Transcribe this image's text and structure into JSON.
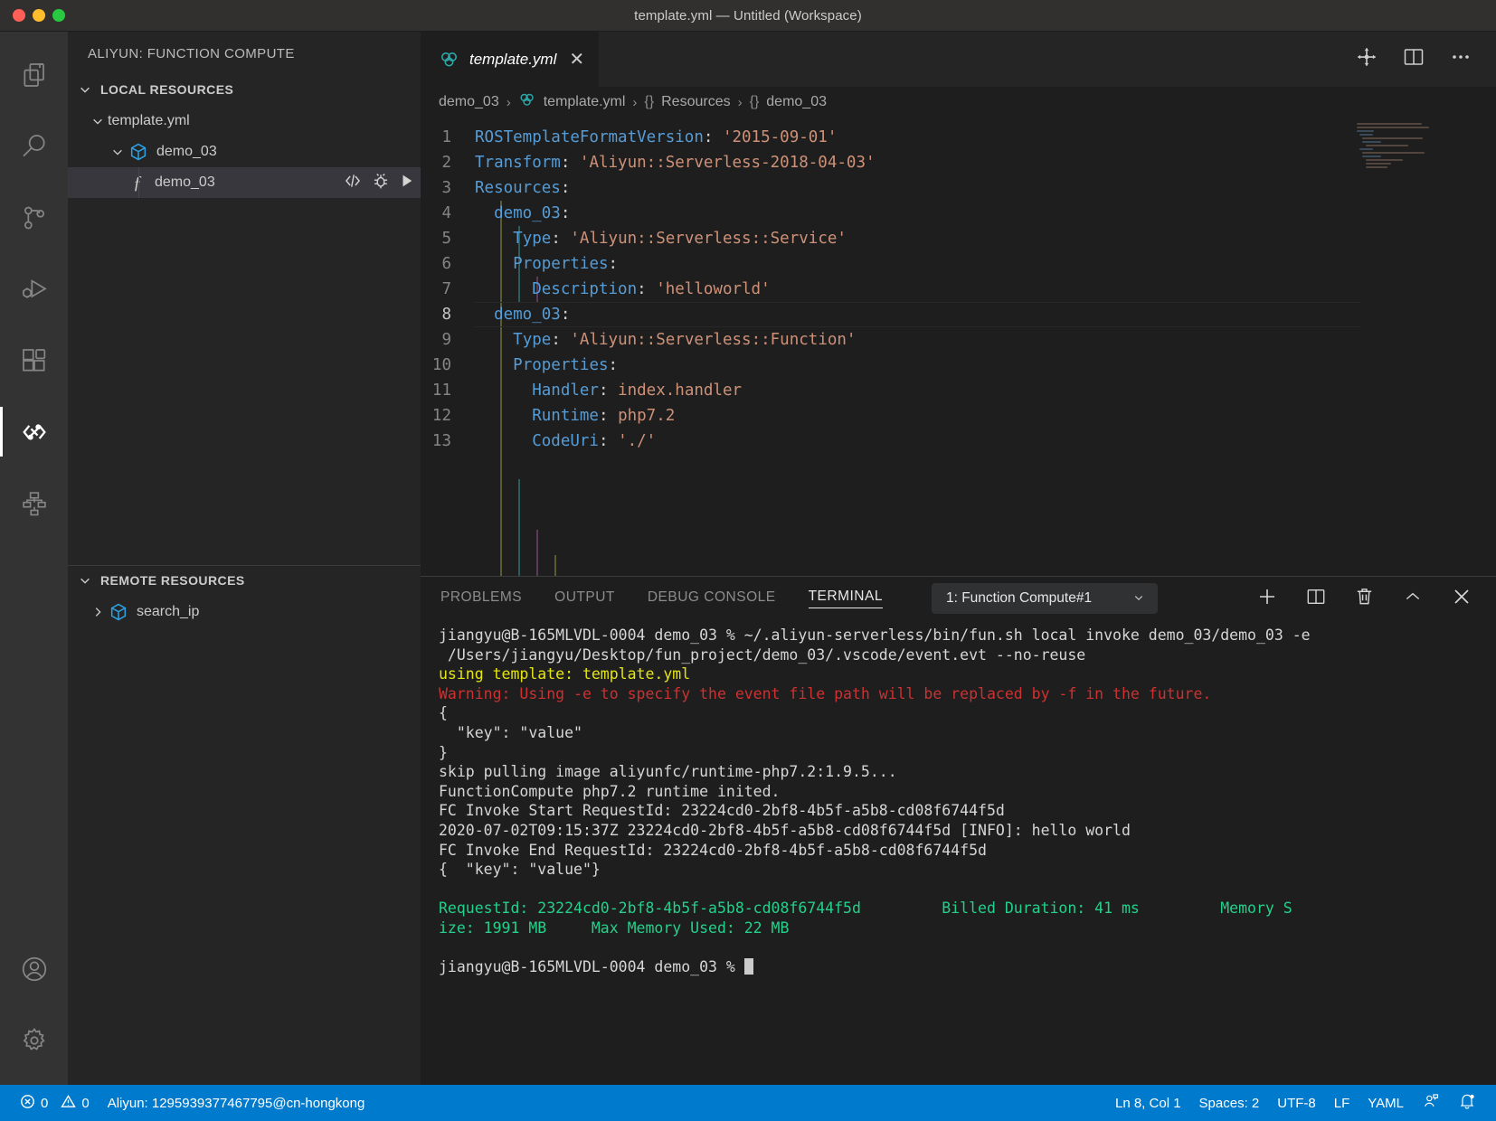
{
  "window": {
    "title": "template.yml — Untitled (Workspace)"
  },
  "activitybar": {
    "items": [
      {
        "name": "explorer",
        "icon": "files-icon",
        "active": false
      },
      {
        "name": "search",
        "icon": "search-icon",
        "active": false
      },
      {
        "name": "source-control",
        "icon": "source-control-icon",
        "active": false
      },
      {
        "name": "run-and-debug",
        "icon": "debug-icon",
        "active": false
      },
      {
        "name": "extensions",
        "icon": "extensions-icon",
        "active": false
      },
      {
        "name": "function-compute",
        "icon": "serverless-icon",
        "active": true
      },
      {
        "name": "remote-explorer",
        "icon": "sitemap-icon",
        "active": false
      }
    ],
    "bottom": [
      {
        "name": "accounts",
        "icon": "account-icon"
      },
      {
        "name": "manage",
        "icon": "gear-icon"
      }
    ]
  },
  "sidebar": {
    "title": "ALIYUN: FUNCTION COMPUTE",
    "local": {
      "header": "LOCAL RESOURCES",
      "items": [
        {
          "label": "template.yml",
          "level": 1,
          "twisty": "expanded",
          "icon": "none",
          "selected": false
        },
        {
          "label": "demo_03",
          "level": 2,
          "twisty": "expanded",
          "icon": "cube-icon",
          "selected": false
        },
        {
          "label": "demo_03",
          "level": 3,
          "twisty": "none",
          "icon": "function-icon",
          "selected": true,
          "actions": [
            "code-icon",
            "bug-icon",
            "play-icon"
          ]
        }
      ]
    },
    "remote": {
      "header": "REMOTE RESOURCES",
      "items": [
        {
          "label": "search_ip",
          "level": 1,
          "twisty": "collapsed",
          "icon": "cube-icon",
          "selected": false
        }
      ]
    }
  },
  "editor": {
    "tab": {
      "label": "template.yml",
      "icon": "yaml-cloud-icon",
      "close": "✕"
    },
    "tab_actions": [
      "split-layout-icon",
      "split-editor-icon",
      "more-actions-icon"
    ],
    "breadcrumbs": [
      {
        "text": "demo_03",
        "icon": "none"
      },
      {
        "text": "template.yml",
        "icon": "yaml-cloud-icon"
      },
      {
        "text": "Resources",
        "icon": "braces"
      },
      {
        "text": "demo_03",
        "icon": "braces"
      }
    ],
    "separator": "❯",
    "current_line": 8,
    "lines": [
      {
        "n": 1,
        "tokens": [
          {
            "t": "ROSTemplateFormatVersion",
            "c": "k"
          },
          {
            "t": ": ",
            "c": "p"
          },
          {
            "t": "'2015-09-01'",
            "c": "s"
          }
        ]
      },
      {
        "n": 2,
        "tokens": [
          {
            "t": "Transform",
            "c": "k"
          },
          {
            "t": ": ",
            "c": "p"
          },
          {
            "t": "'Aliyun::Serverless-2018-04-03'",
            "c": "s"
          }
        ]
      },
      {
        "n": 3,
        "tokens": [
          {
            "t": "Resources",
            "c": "k"
          },
          {
            "t": ":",
            "c": "p"
          }
        ]
      },
      {
        "n": 4,
        "tokens": [
          {
            "t": "  ",
            "c": "p"
          },
          {
            "t": "demo_03",
            "c": "k"
          },
          {
            "t": ":",
            "c": "p"
          }
        ]
      },
      {
        "n": 5,
        "tokens": [
          {
            "t": "    ",
            "c": "p"
          },
          {
            "t": "Type",
            "c": "k"
          },
          {
            "t": ": ",
            "c": "p"
          },
          {
            "t": "'Aliyun::Serverless::Service'",
            "c": "s"
          }
        ]
      },
      {
        "n": 6,
        "tokens": [
          {
            "t": "    ",
            "c": "p"
          },
          {
            "t": "Properties",
            "c": "k"
          },
          {
            "t": ":",
            "c": "p"
          }
        ]
      },
      {
        "n": 7,
        "tokens": [
          {
            "t": "      ",
            "c": "p"
          },
          {
            "t": "Description",
            "c": "k"
          },
          {
            "t": ": ",
            "c": "p"
          },
          {
            "t": "'helloworld'",
            "c": "s"
          }
        ]
      },
      {
        "n": 8,
        "tokens": [
          {
            "t": "  ",
            "c": "p"
          },
          {
            "t": "demo_03",
            "c": "k"
          },
          {
            "t": ":",
            "c": "p"
          }
        ]
      },
      {
        "n": 9,
        "tokens": [
          {
            "t": "    ",
            "c": "p"
          },
          {
            "t": "Type",
            "c": "k"
          },
          {
            "t": ": ",
            "c": "p"
          },
          {
            "t": "'Aliyun::Serverless::Function'",
            "c": "s"
          }
        ]
      },
      {
        "n": 10,
        "tokens": [
          {
            "t": "    ",
            "c": "p"
          },
          {
            "t": "Properties",
            "c": "k"
          },
          {
            "t": ":",
            "c": "p"
          }
        ]
      },
      {
        "n": 11,
        "tokens": [
          {
            "t": "      ",
            "c": "p"
          },
          {
            "t": "Handler",
            "c": "k"
          },
          {
            "t": ": ",
            "c": "p"
          },
          {
            "t": "index.handler",
            "c": "v"
          }
        ]
      },
      {
        "n": 12,
        "tokens": [
          {
            "t": "      ",
            "c": "p"
          },
          {
            "t": "Runtime",
            "c": "k"
          },
          {
            "t": ": ",
            "c": "p"
          },
          {
            "t": "php7.2",
            "c": "v"
          }
        ]
      },
      {
        "n": 13,
        "tokens": [
          {
            "t": "      ",
            "c": "p"
          },
          {
            "t": "CodeUri",
            "c": "k"
          },
          {
            "t": ": ",
            "c": "p"
          },
          {
            "t": "'./'",
            "c": "s"
          }
        ]
      }
    ]
  },
  "panel": {
    "tabs": [
      {
        "label": "PROBLEMS",
        "active": false
      },
      {
        "label": "OUTPUT",
        "active": false
      },
      {
        "label": "DEBUG CONSOLE",
        "active": false
      },
      {
        "label": "TERMINAL",
        "active": true
      }
    ],
    "terminal_selector": {
      "value": "1: Function Compute#1",
      "chevron": "⌄"
    },
    "actions": [
      "new-terminal-icon",
      "split-terminal-icon",
      "kill-terminal-icon",
      "maximize-panel-icon",
      "close-panel-icon"
    ],
    "terminal_lines": [
      {
        "text": "jiangyu@B-165MLVDL-0004 demo_03 % ~/.aliyun-serverless/bin/fun.sh local invoke demo_03/demo_03 -e",
        "color": "default"
      },
      {
        "text": " /Users/jiangyu/Desktop/fun_project/demo_03/.vscode/event.evt --no-reuse",
        "color": "default"
      },
      {
        "text": "using template: template.yml",
        "color": "yellow"
      },
      {
        "text": "Warning: Using -e to specify the event file path will be replaced by -f in the future.",
        "color": "red"
      },
      {
        "text": "{",
        "color": "default"
      },
      {
        "text": "  \"key\": \"value\"",
        "color": "default"
      },
      {
        "text": "}",
        "color": "default"
      },
      {
        "text": "skip pulling image aliyunfc/runtime-php7.2:1.9.5...",
        "color": "default"
      },
      {
        "text": "FunctionCompute php7.2 runtime inited.",
        "color": "default"
      },
      {
        "text": "FC Invoke Start RequestId: 23224cd0-2bf8-4b5f-a5b8-cd08f6744f5d",
        "color": "default"
      },
      {
        "text": "2020-07-02T09:15:37Z 23224cd0-2bf8-4b5f-a5b8-cd08f6744f5d [INFO]: hello world",
        "color": "default"
      },
      {
        "text": "FC Invoke End RequestId: 23224cd0-2bf8-4b5f-a5b8-cd08f6744f5d",
        "color": "default"
      },
      {
        "text": "{  \"key\": \"value\"}",
        "color": "default"
      },
      {
        "text": "",
        "color": "default"
      },
      {
        "text": "RequestId: 23224cd0-2bf8-4b5f-a5b8-cd08f6744f5d         Billed Duration: 41 ms         Memory S",
        "color": "green"
      },
      {
        "text": "ize: 1991 MB     Max Memory Used: 22 MB",
        "color": "green"
      },
      {
        "text": "",
        "color": "default"
      },
      {
        "text": "jiangyu@B-165MLVDL-0004 demo_03 % ",
        "color": "default",
        "cursor": true
      }
    ]
  },
  "statusbar": {
    "errors": "0",
    "warnings": "0",
    "account": "Aliyun: 1295939377467795@cn-hongkong",
    "position": "Ln 8, Col 1",
    "spaces": "Spaces: 2",
    "encoding": "UTF-8",
    "eol": "LF",
    "language": "YAML",
    "feedback_icon": "feedback-icon",
    "bell_icon": "bell-dot-icon"
  },
  "colors": {
    "accent": "#007acc",
    "sidebar_bg": "#252526",
    "editor_bg": "#1e1e1e",
    "activitybar_bg": "#333333",
    "terminal_green": "#23d18b",
    "terminal_red": "#cd3131",
    "terminal_yellow": "#e5e510",
    "yaml_key": "#569cd6",
    "yaml_string": "#ce9178"
  }
}
